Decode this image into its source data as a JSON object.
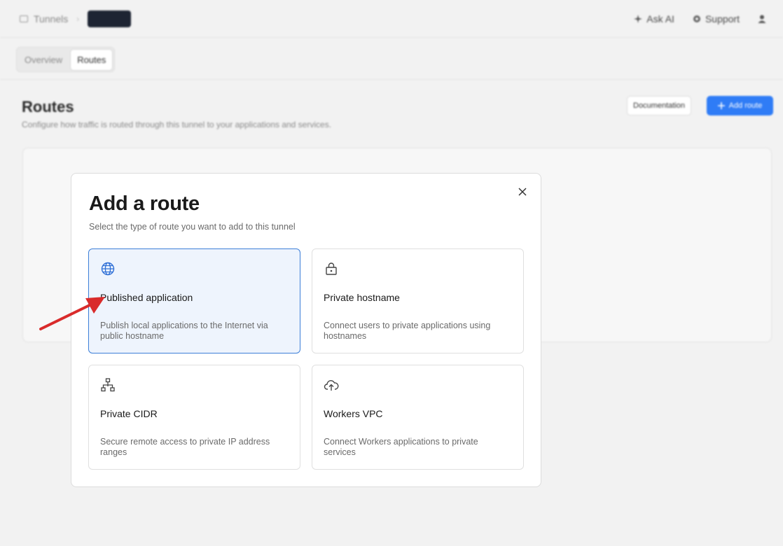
{
  "topbar": {
    "breadcrumb_root": "Tunnels",
    "breadcrumb_sep": "›",
    "ask_ai": "Ask AI",
    "support": "Support"
  },
  "tabs": [
    {
      "label": "Overview"
    },
    {
      "label": "Routes",
      "active": true
    }
  ],
  "page": {
    "title": "Routes",
    "subtitle": "Configure how traffic is routed through this tunnel to your applications and services.",
    "documentation_label": "Documentation",
    "add_route_label": "Add route"
  },
  "modal": {
    "title": "Add a route",
    "subtitle": "Select the type of route you want to add to this tunnel",
    "close_icon": "close-icon",
    "options": [
      {
        "title": "Published application",
        "description": "Publish local applications to the Internet via public hostname",
        "icon": "globe-icon",
        "selected": true
      },
      {
        "title": "Private hostname",
        "description": "Connect users to private applications using hostnames",
        "icon": "lock-icon",
        "selected": false
      },
      {
        "title": "Private CIDR",
        "description": "Secure remote access to private IP address ranges",
        "icon": "network-icon",
        "selected": false
      },
      {
        "title": "Workers VPC",
        "description": "Connect Workers applications to private services",
        "icon": "cloud-upload-icon",
        "selected": false
      }
    ]
  },
  "colors": {
    "accent": "#2f7cf6",
    "selected_border": "#3d7fd8",
    "selected_bg": "#eef4fd",
    "annotation_arrow": "#d92b2b"
  }
}
